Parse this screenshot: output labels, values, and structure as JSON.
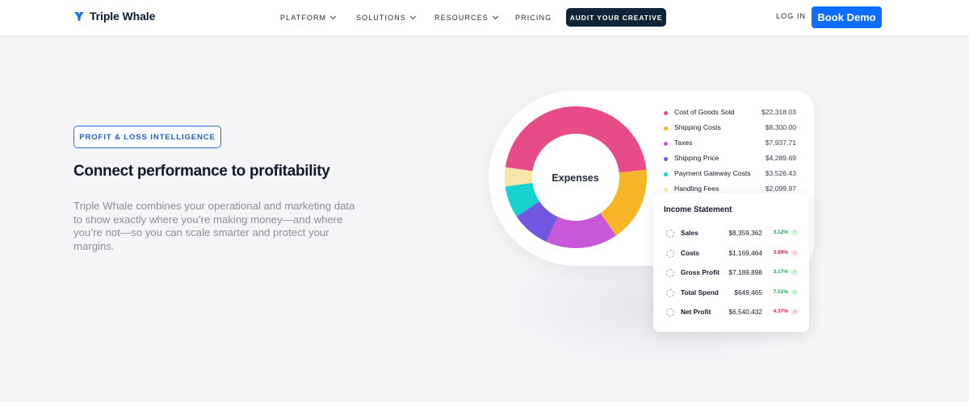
{
  "brand": {
    "name": "Triple Whale",
    "logo_icon": "triple-whale-logo-icon",
    "accent": "#0d6efd"
  },
  "nav": {
    "items": [
      {
        "label": "PLATFORM",
        "has_dropdown": true
      },
      {
        "label": "SOLUTIONS",
        "has_dropdown": true
      },
      {
        "label": "RESOURCES",
        "has_dropdown": true
      },
      {
        "label": "PRICING",
        "has_dropdown": false
      }
    ],
    "audit_label": "AUDIT YOUR CREATIVE",
    "login_label": "LOG IN",
    "book_demo_label": "Book Demo"
  },
  "hero": {
    "badge": "PROFIT & LOSS INTELLIGENCE",
    "headline": "Connect performance to profitability",
    "description": "Triple Whale combines your operational and marketing data to show exactly where you’re making money—and where you’re not—so you can scale smarter and protect your margins."
  },
  "expenses": {
    "center_label": "Expenses",
    "items": [
      {
        "name": "Cost of Goods Sold",
        "value": "$22,318.03",
        "amount": 22318.03,
        "color": "#e84c88"
      },
      {
        "name": "Shipping Costs",
        "value": "$8,300.00",
        "amount": 8300.0,
        "color": "#f5b526"
      },
      {
        "name": "Taxes",
        "value": "$7,937.71",
        "amount": 7937.71,
        "color": "#c758d8"
      },
      {
        "name": "Shipping Price",
        "value": "$4,289.69",
        "amount": 4289.69,
        "color": "#7357e0"
      },
      {
        "name": "Payment Gateway Costs",
        "value": "$3,526.43",
        "amount": 3526.43,
        "color": "#17d3d0"
      },
      {
        "name": "Handling Fees",
        "value": "$2,099.97",
        "amount": 2099.97,
        "color": "#f8e6a8"
      }
    ]
  },
  "income_statement": {
    "title": "Income Statement",
    "rows": [
      {
        "name": "Sales",
        "value": "$8,359,362",
        "pct": "3.12%",
        "trend": "up"
      },
      {
        "name": "Costs",
        "value": "$1,169,464",
        "pct": "3.89%",
        "trend": "down"
      },
      {
        "name": "Gross Profit",
        "value": "$7,189,898",
        "pct": "3.17%",
        "trend": "up"
      },
      {
        "name": "Total Spend",
        "value": "$649,465",
        "pct": "7.51%",
        "trend": "up"
      },
      {
        "name": "Net Profit",
        "value": "$6,540,432",
        "pct": "4.37%",
        "trend": "down"
      }
    ]
  }
}
